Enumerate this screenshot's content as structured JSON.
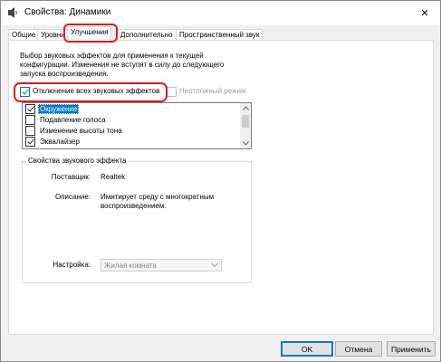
{
  "window": {
    "title": "Свойства: Динамики",
    "close_symbol": "✕"
  },
  "tabs": [
    {
      "label": "Общие"
    },
    {
      "label": "Уровни"
    },
    {
      "label": "Улучшения",
      "active": true
    },
    {
      "label": "Дополнительно"
    },
    {
      "label": "Пространственный звук"
    }
  ],
  "description": [
    "Выбор звуковых эффектов для применения к текущей",
    "конфигурации. Изменения не вступят в силу до следующего",
    "запуска воспроизведения."
  ],
  "disable_all": {
    "label": "Отключение всех звуковых эффектов",
    "checked": true
  },
  "immediate_mode": {
    "label": "Неотложный режим",
    "checked": false,
    "enabled": false
  },
  "effects": [
    {
      "label": "Окружение",
      "checked": true,
      "selected": true
    },
    {
      "label": "Подавление голоса",
      "checked": false
    },
    {
      "label": "Изменение высоты тона",
      "checked": false
    },
    {
      "label": "Эквалайзер",
      "checked": true
    }
  ],
  "properties": {
    "group_title": "Свойства звукового эффекта",
    "provider_label": "Поставщик:",
    "provider_value": "Realtek",
    "description_label": "Описание:",
    "description_value_line1": "Имитирует среду с многократным",
    "description_value_line2": "воспроизведением.",
    "setting_label": "Настройка:",
    "setting_value": "Жилая комната"
  },
  "buttons": {
    "ok": "OK",
    "cancel": "Отмена",
    "apply": "Применить"
  },
  "colors": {
    "highlight": "#e21a1a",
    "selection": "#0078d7"
  }
}
